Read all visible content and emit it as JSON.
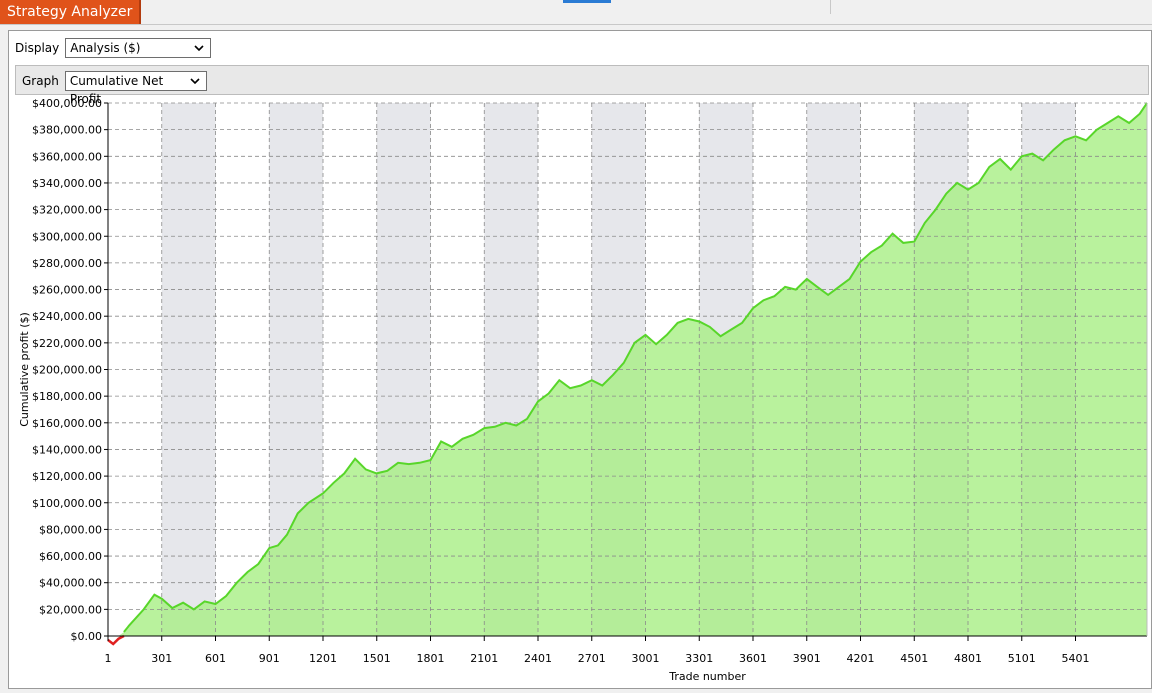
{
  "window": {
    "title": "Strategy Analyzer"
  },
  "controls": {
    "display_label": "Display",
    "display_value": "Analysis ($)",
    "graph_label": "Graph",
    "graph_value": "Cumulative Net Profit"
  },
  "colors": {
    "tab_accent": "#e0531a",
    "profit_line": "#58d62a",
    "profit_fill": "#a8ef85",
    "loss": "#e02020",
    "band": "#e6e7eb"
  },
  "chart_data": {
    "type": "area",
    "title": "",
    "xlabel": "Trade number",
    "ylabel": "Cumulative profit ($)",
    "xlim": [
      1,
      5800
    ],
    "ylim": [
      0,
      400000
    ],
    "x_ticks": [
      "1",
      "301",
      "601",
      "901",
      "1201",
      "1501",
      "1801",
      "2101",
      "2401",
      "2701",
      "3001",
      "3301",
      "3601",
      "3901",
      "4201",
      "4501",
      "4801",
      "5101",
      "5401"
    ],
    "y_ticks": [
      "$0.00",
      "$20,000.00",
      "$40,000.00",
      "$60,000.00",
      "$80,000.00",
      "$100,000.00",
      "$120,000.00",
      "$140,000.00",
      "$160,000.00",
      "$180,000.00",
      "$200,000.00",
      "$220,000.00",
      "$240,000.00",
      "$260,000.00",
      "$280,000.00",
      "$300,000.00",
      "$320,000.00",
      "$340,000.00",
      "$360,000.00",
      "$380,000.00",
      "$400,000.00"
    ],
    "grid": true,
    "legend": "none",
    "series": [
      {
        "x": [
          1,
          30,
          60,
          90,
          120,
          200,
          260,
          301,
          360,
          420,
          480,
          540,
          601,
          660,
          720,
          780,
          840,
          901,
          950,
          1000,
          1060,
          1120,
          1201,
          1260,
          1320,
          1380,
          1440,
          1500,
          1560,
          1620,
          1680,
          1740,
          1801,
          1860,
          1920,
          1980,
          2040,
          2101,
          2160,
          2220,
          2280,
          2340,
          2401,
          2460,
          2520,
          2580,
          2640,
          2701,
          2760,
          2820,
          2880,
          2940,
          3001,
          3060,
          3120,
          3180,
          3240,
          3301,
          3360,
          3420,
          3480,
          3540,
          3601,
          3660,
          3720,
          3780,
          3840,
          3901,
          3960,
          4020,
          4080,
          4140,
          4201,
          4260,
          4320,
          4380,
          4440,
          4501,
          4560,
          4620,
          4680,
          4740,
          4801,
          4860,
          4920,
          4980,
          5040,
          5101,
          5160,
          5220,
          5280,
          5340,
          5401,
          5460,
          5520,
          5580,
          5640,
          5700,
          5760,
          5800
        ],
        "y": [
          -3000,
          -6000,
          -2000,
          3000,
          8000,
          20000,
          31000,
          28000,
          21000,
          25000,
          20000,
          26000,
          24000,
          30000,
          40000,
          48000,
          54000,
          66000,
          68000,
          76000,
          92000,
          100000,
          107000,
          115000,
          122000,
          133000,
          125000,
          122000,
          124000,
          130000,
          129000,
          130000,
          132000,
          146000,
          142000,
          148000,
          151000,
          156000,
          157000,
          160000,
          158000,
          163000,
          176000,
          182000,
          192000,
          186000,
          188000,
          192000,
          188000,
          196000,
          205000,
          220000,
          226000,
          219000,
          226000,
          235000,
          238000,
          236000,
          232000,
          225000,
          230000,
          235000,
          246000,
          252000,
          255000,
          262000,
          260000,
          268000,
          262000,
          256000,
          262000,
          268000,
          281000,
          288000,
          293000,
          302000,
          295000,
          296000,
          310000,
          320000,
          332000,
          340000,
          335000,
          340000,
          352000,
          358000,
          350000,
          360000,
          362000,
          357000,
          365000,
          372000,
          375000,
          372000,
          380000,
          385000,
          390000,
          385000,
          392000,
          400000
        ]
      }
    ]
  }
}
